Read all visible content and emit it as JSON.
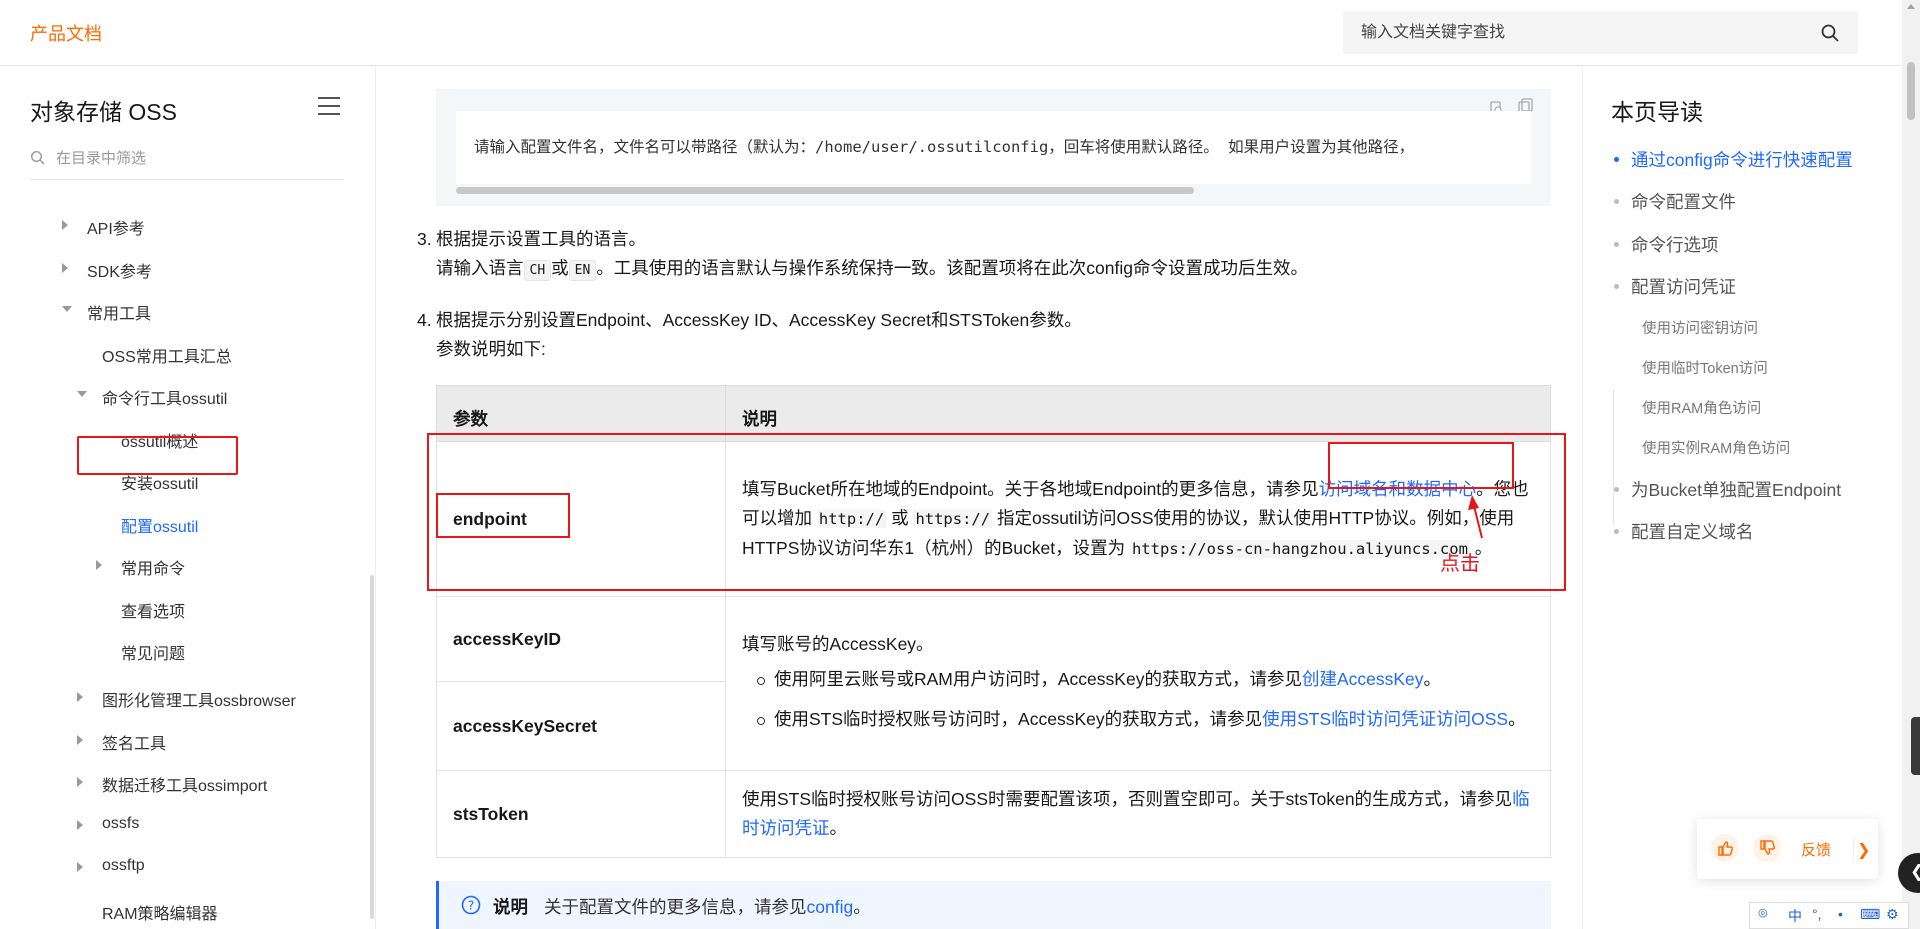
{
  "header": {
    "brand": "产品文档",
    "search_placeholder": "输入文档关键字查找"
  },
  "sidebar": {
    "title": "对象存储 OSS",
    "filter_placeholder": "在目录中筛选",
    "items": [
      {
        "label": "API参考"
      },
      {
        "label": "SDK参考"
      },
      {
        "label": "常用工具"
      },
      {
        "label": "OSS常用工具汇总"
      },
      {
        "label": "命令行工具ossutil"
      },
      {
        "label": "ossutil概述"
      },
      {
        "label": "安装ossutil"
      },
      {
        "label": "配置ossutil"
      },
      {
        "label": "常用命令"
      },
      {
        "label": "查看选项"
      },
      {
        "label": "常见问题"
      },
      {
        "label": "图形化管理工具ossbrowser"
      },
      {
        "label": "签名工具"
      },
      {
        "label": "数据迁移工具ossimport"
      },
      {
        "label": "ossfs"
      },
      {
        "label": "ossftp"
      },
      {
        "label": "RAM策略编辑器"
      }
    ]
  },
  "content": {
    "code_line": "请输入配置文件名，文件名可以带路径（默认为：/home/user/.ossutilconfig，回车将使用默认路径。 如果用户设置为其他路径，",
    "step3": {
      "num": "3.",
      "title": "根据提示设置工具的语言。",
      "text_a": "请输入语言",
      "code_ch": "CH",
      "text_b": "或",
      "code_en": "EN",
      "text_c": "。工具使用的语言默认与操作系统保持一致。该配置项将在此次config命令设置成功后生效。"
    },
    "step4": {
      "num": "4.",
      "title": "根据提示分别设置Endpoint、AccessKey ID、AccessKey Secret和STSToken参数。",
      "subtitle": "参数说明如下:"
    },
    "table": {
      "headers": [
        "参数",
        "说明"
      ],
      "endpoint": {
        "name": "endpoint",
        "t1": "填写Bucket所在地域的Endpoint。关于各地域Endpoint的更多信息，请参见",
        "link": "访问域名和数据中心",
        "t2": "。您也可以增加 ",
        "c1": "http://",
        "t3": " 或 ",
        "c2": "https://",
        "t4": " 指定ossutil访问OSS使用的协议，默认使用HTTP协议。例如，使用HTTPS协议访问华东1（杭州）的Bucket，设置为 ",
        "c3": "https://oss-cn-hangzhou.aliyuncs.com",
        "t5": " 。"
      },
      "accessKeyID": "accessKeyID",
      "accessKeySecret": "accessKeySecret",
      "ak_desc": "填写账号的AccessKey。",
      "ak_li1_a": "使用阿里云账号或RAM用户访问时，AccessKey的获取方式，请参见",
      "ak_li1_link": "创建AccessKey",
      "ak_li1_b": "。",
      "ak_li2_a": "使用STS临时授权账号访问时，AccessKey的获取方式，请参见",
      "ak_li2_link": "使用STS临时访问凭证访问OSS",
      "ak_li2_b": "。",
      "stsToken": "stsToken",
      "sts_a": "使用STS临时授权账号访问OSS时需要配置该项，否则置空即可。关于stsToken的生成方式，请参见",
      "sts_link": "临时访问凭证",
      "sts_b": "。"
    },
    "note": {
      "title": "说明",
      "text": "关于配置文件的更多信息，请参见",
      "link": "config",
      "end": "。"
    },
    "annotation": "点击"
  },
  "toc": {
    "title": "本页导读",
    "items": [
      "通过config命令进行快速配置",
      "命令配置文件",
      "命令行选项",
      "配置访问凭证",
      "为Bucket单独配置Endpoint",
      "配置自定义域名"
    ],
    "subitems": [
      "使用访问密钥访问",
      "使用临时Token访问",
      "使用RAM角色访问",
      "使用实例RAM角色访问"
    ]
  },
  "feedback": {
    "label": "反馈"
  },
  "ime": {
    "lang": "中"
  },
  "colors": {
    "brand": "#ff6a00",
    "link": "#1f69ff",
    "annotation": "#e8151b"
  }
}
